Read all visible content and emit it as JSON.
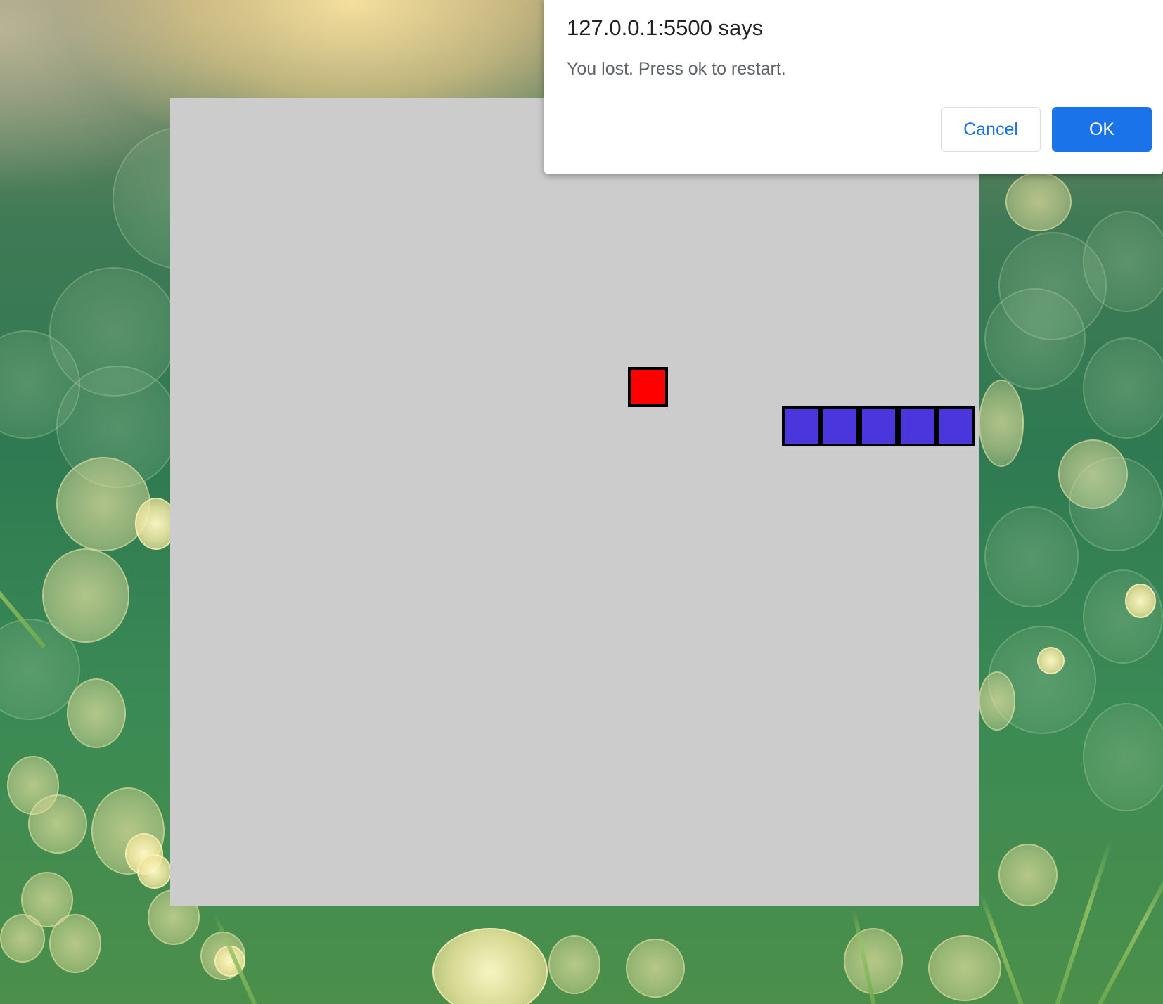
{
  "dialog": {
    "title": "127.0.0.1:5500 says",
    "message": "You lost. Press ok to restart.",
    "cancel_label": "Cancel",
    "ok_label": "OK"
  },
  "game": {
    "board_color": "#cccccc",
    "food_color": "#ff0000",
    "snake_color": "#4b35dd",
    "snake_length": 5
  },
  "colors": {
    "accent": "#1a73e8"
  }
}
